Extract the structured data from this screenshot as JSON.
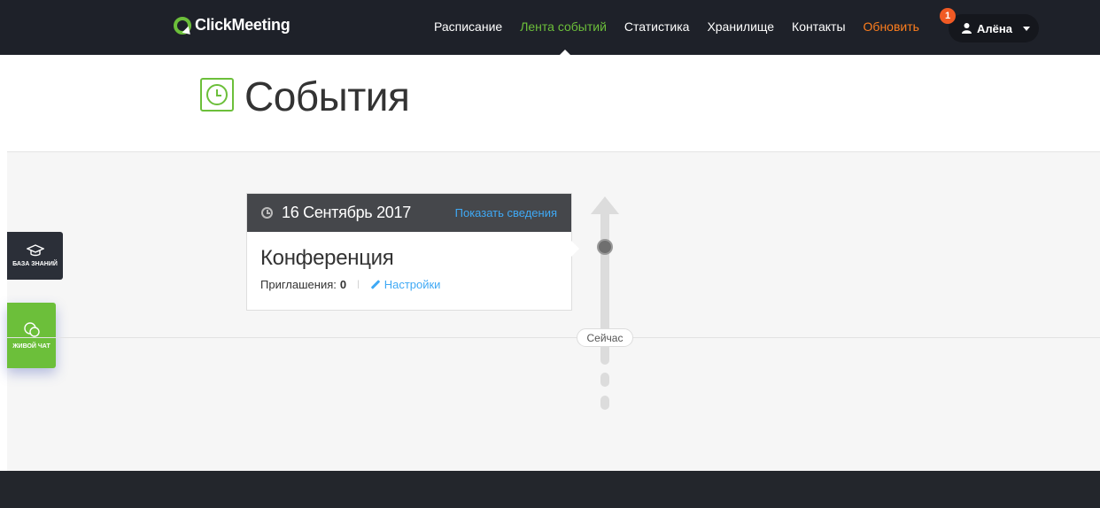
{
  "app": {
    "logo_text": "ClickMeeting"
  },
  "nav": {
    "items": [
      {
        "label": "Расписание"
      },
      {
        "label": "Лента событий"
      },
      {
        "label": "Статистика"
      },
      {
        "label": "Хранилище"
      },
      {
        "label": "Контакты"
      },
      {
        "label": "Обновить"
      }
    ],
    "notification_count": "1",
    "user_name": "Алёна"
  },
  "page": {
    "title": "События"
  },
  "widgets": {
    "knowledge_base": "БАЗА ЗНАНИЙ",
    "live_chat": "ЖИВОЙ ЧАТ"
  },
  "event": {
    "date": "16 Сентябрь 2017",
    "details_link": "Показать сведения",
    "title": "Конференция",
    "invitations_label": "Приглашения:",
    "invitations_count": "0",
    "settings_link": "Настройки"
  },
  "timeline": {
    "now_label": "Сейчас"
  },
  "colors": {
    "accent_green": "#6cbf3a",
    "upgrade_orange": "#ff7e1d",
    "link_blue": "#3fa9f5",
    "nav_bg": "#1e2129"
  }
}
